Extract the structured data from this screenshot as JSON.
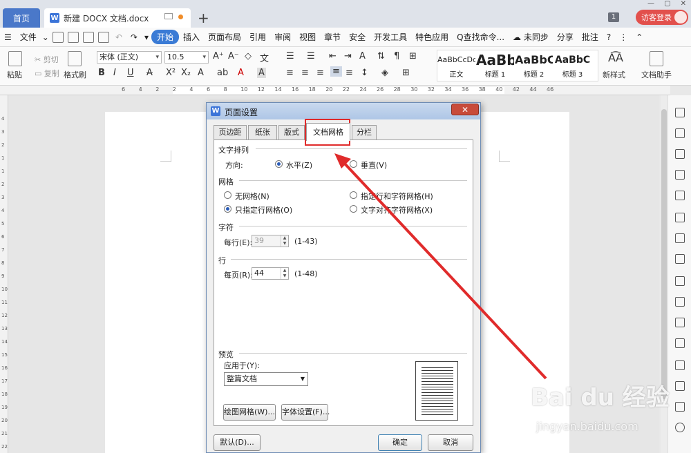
{
  "titlebar": {
    "home_tab": "首页",
    "doc_tab": "新建 DOCX 文档.docx",
    "doc_icon": "W",
    "count_badge": "1",
    "visitor_login": "访客登录"
  },
  "menubar": {
    "file": "文件",
    "items": [
      "开始",
      "插入",
      "页面布局",
      "引用",
      "审阅",
      "视图",
      "章节",
      "安全",
      "开发工具",
      "特色应用"
    ],
    "active_index": 0,
    "search": "Q查找命令...",
    "sync": "未同步",
    "share": "分享",
    "annotate": "批注"
  },
  "ribbon": {
    "paste": "粘贴",
    "cut": "剪切",
    "copy": "复制",
    "format_painter": "格式刷",
    "font_name": "宋体 (正文)",
    "font_size": "10.5",
    "styles": [
      {
        "preview": "AaBbCcDd",
        "name": "正文"
      },
      {
        "preview": "AaBb",
        "name": "标题 1"
      },
      {
        "preview": "AaBbC",
        "name": "标题 2"
      },
      {
        "preview": "AaBbC",
        "name": "标题 3"
      }
    ],
    "new_style": "新样式",
    "doc_helper": "文档助手"
  },
  "ruler": {
    "numbers": [
      "6",
      "4",
      "2",
      "2",
      "4",
      "6",
      "8",
      "10",
      "12",
      "14",
      "16",
      "18",
      "20",
      "22",
      "24",
      "26",
      "28",
      "30",
      "32",
      "34",
      "36",
      "38",
      "40",
      "42",
      "44",
      "46"
    ]
  },
  "vruler": {
    "numbers": [
      "4",
      "3",
      "2",
      "1",
      "1",
      "2",
      "3",
      "4",
      "5",
      "6",
      "7",
      "8",
      "9",
      "10",
      "11",
      "12",
      "13",
      "14",
      "15",
      "16",
      "17",
      "18",
      "19",
      "20",
      "21",
      "22",
      "23"
    ]
  },
  "dialog": {
    "icon": "W",
    "title": "页面设置",
    "tabs": [
      "页边距",
      "纸张",
      "版式",
      "文档网格",
      "分栏"
    ],
    "selected_tab": 3,
    "text_direction": {
      "section": "文字排列",
      "label": "方向:",
      "horizontal": "水平(Z)",
      "vertical": "垂直(V)",
      "selected": "horizontal"
    },
    "grid": {
      "section": "网格",
      "no_grid": "无网格(N)",
      "line_char_grid": "指定行和字符网格(H)",
      "line_grid_only": "只指定行网格(O)",
      "snap_to_char": "文字对齐字符网格(X)",
      "selected": "line_grid_only"
    },
    "characters": {
      "section": "字符",
      "per_line_label": "每行(E):",
      "per_line_value": "39",
      "per_line_range": "(1-43)"
    },
    "lines": {
      "section": "行",
      "per_page_label": "每页(R):",
      "per_page_value": "44",
      "per_page_range": "(1-48)"
    },
    "preview": {
      "section": "预览",
      "apply_to_label": "应用于(Y):",
      "apply_to_value": "整篇文档"
    },
    "draw_grid_button": "绘图网格(W)...",
    "font_settings_button": "字体设置(F)...",
    "default_button": "默认(D)...",
    "ok_button": "确定",
    "cancel_button": "取消"
  },
  "watermark": {
    "brand": "Bai du 经验",
    "url": "jingyan.baidu.com"
  },
  "colors": {
    "accent_blue": "#3a7bd5",
    "highlight_red": "#e02b2b",
    "visitor_red": "#e2504c"
  }
}
